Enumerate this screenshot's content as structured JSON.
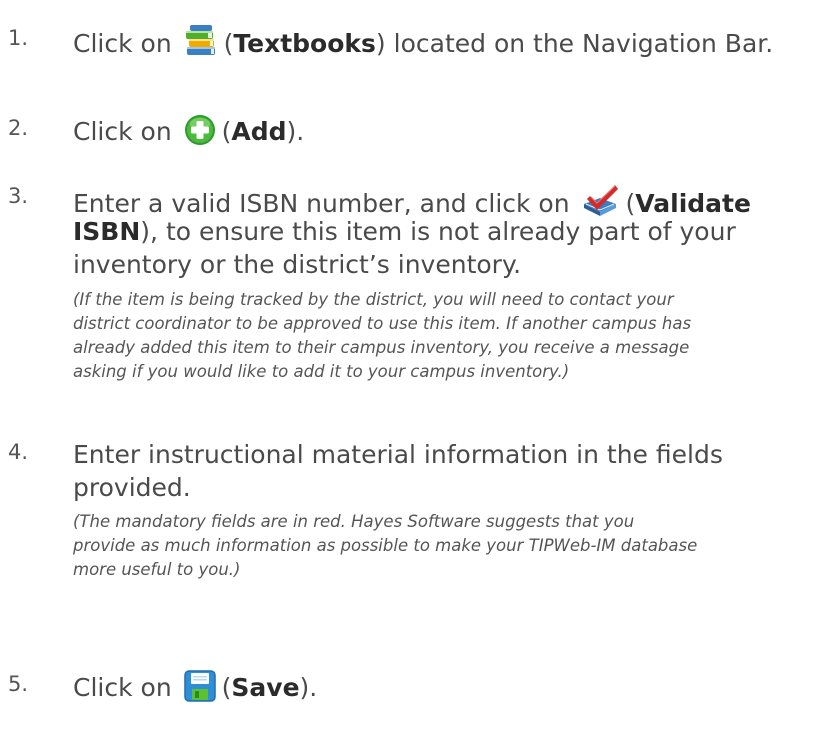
{
  "steps": [
    {
      "number": "1.",
      "prefix": "Click on",
      "icon": "textbooks-icon",
      "open": "(",
      "bold": "Textbooks",
      "close": ")",
      "suffix": " located on the Navigation Bar."
    },
    {
      "number": "2.",
      "prefix": "Click on",
      "icon": "add-icon",
      "open": "(",
      "bold": "Add",
      "close": ")."
    },
    {
      "number": "3.",
      "line1_prefix": "Enter a valid ISBN number, and click on",
      "icon": "validate-isbn-icon",
      "open": "(",
      "bold_line1": "Validate",
      "bold_line2": "ISBN",
      "line2_rest": "), to ensure this item is not already part of your",
      "line3": "inventory or the district’s inventory.",
      "note": [
        "(If the item is being tracked by the district, you will need to contact your",
        "district coordinator to be approved to use this item.  If another campus has",
        "already added this item to their campus inventory, you receive a message",
        "asking if you would like to add it to your campus inventory.)"
      ]
    },
    {
      "number": "4.",
      "line1": "Enter instructional material information in the fields",
      "line2": "provided.",
      "note": [
        "(The mandatory fields are in red.  Hayes Software suggests that you",
        "provide as much information as possible to make your TIPWeb-IM database",
        "more useful to you.)"
      ]
    },
    {
      "number": "5.",
      "prefix": "Click on",
      "icon": "save-icon",
      "open": "(",
      "bold": "Save",
      "close": ")."
    }
  ]
}
